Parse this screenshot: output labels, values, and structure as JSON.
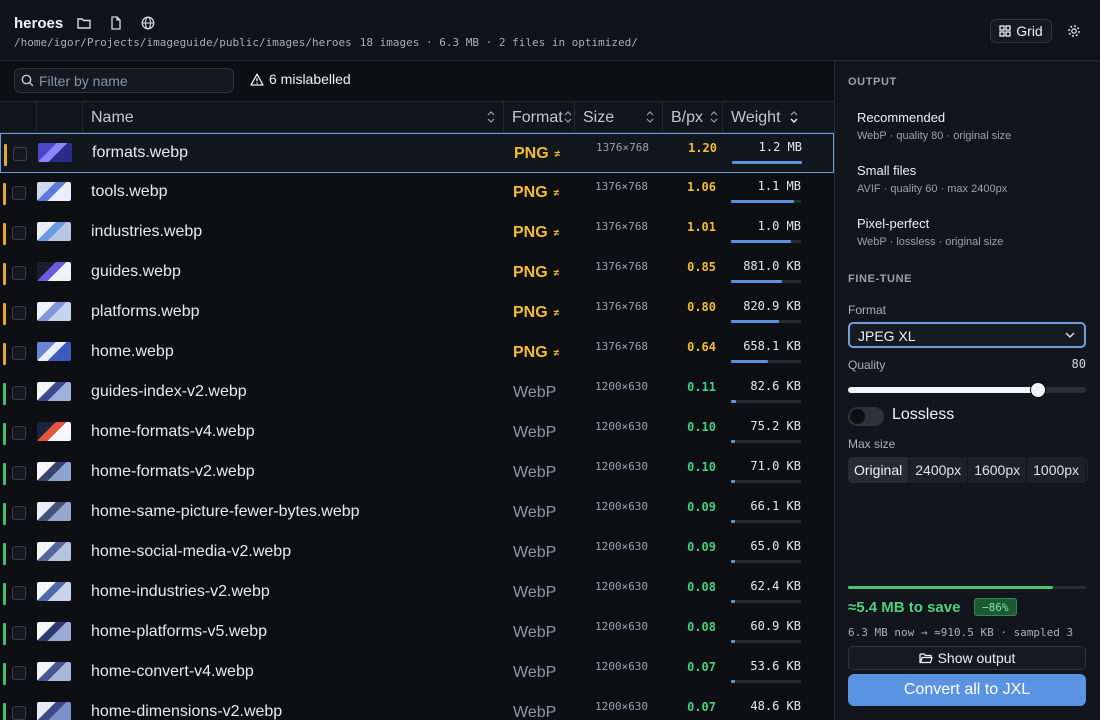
{
  "header": {
    "title": "heroes",
    "path": "/home/igor/Projects/imageguide/public/images/heroes",
    "stats": "18 images · 6.3 MB · 2 files in optimized/",
    "grid_label": "Grid"
  },
  "toolbar": {
    "filter_placeholder": "Filter by name",
    "mislabelled": "6 mislabelled"
  },
  "table": {
    "columns": [
      "Name",
      "Format",
      "Size",
      "B/px",
      "Weight"
    ],
    "rows": [
      {
        "name": "formats.webp",
        "format": "PNG",
        "mismatch": "≠",
        "dims": "1376×768",
        "bpx": "1.20",
        "weight": "1.2 MB",
        "weight_fraction": 1.0,
        "selected": true
      },
      {
        "name": "tools.webp",
        "format": "PNG",
        "mismatch": "≠",
        "dims": "1376×768",
        "bpx": "1.06",
        "weight": "1.1 MB",
        "weight_fraction": 0.9
      },
      {
        "name": "industries.webp",
        "format": "PNG",
        "mismatch": "≠",
        "dims": "1376×768",
        "bpx": "1.01",
        "weight": "1.0 MB",
        "weight_fraction": 0.86
      },
      {
        "name": "guides.webp",
        "format": "PNG",
        "mismatch": "≠",
        "dims": "1376×768",
        "bpx": "0.85",
        "weight": "881.0 KB",
        "weight_fraction": 0.73
      },
      {
        "name": "platforms.webp",
        "format": "PNG",
        "mismatch": "≠",
        "dims": "1376×768",
        "bpx": "0.80",
        "weight": "820.9 KB",
        "weight_fraction": 0.68
      },
      {
        "name": "home.webp",
        "format": "PNG",
        "mismatch": "≠",
        "dims": "1376×768",
        "bpx": "0.64",
        "weight": "658.1 KB",
        "weight_fraction": 0.53
      },
      {
        "name": "guides-index-v2.webp",
        "format": "WebP",
        "dims": "1200×630",
        "bpx": "0.11",
        "weight": "82.6 KB",
        "weight_fraction": 0.07
      },
      {
        "name": "home-formats-v4.webp",
        "format": "WebP",
        "dims": "1200×630",
        "bpx": "0.10",
        "weight": "75.2 KB",
        "weight_fraction": 0.06
      },
      {
        "name": "home-formats-v2.webp",
        "format": "WebP",
        "dims": "1200×630",
        "bpx": "0.10",
        "weight": "71.0 KB",
        "weight_fraction": 0.06
      },
      {
        "name": "home-same-picture-fewer-bytes.webp",
        "format": "WebP",
        "dims": "1200×630",
        "bpx": "0.09",
        "weight": "66.1 KB",
        "weight_fraction": 0.05
      },
      {
        "name": "home-social-media-v2.webp",
        "format": "WebP",
        "dims": "1200×630",
        "bpx": "0.09",
        "weight": "65.0 KB",
        "weight_fraction": 0.05
      },
      {
        "name": "home-industries-v2.webp",
        "format": "WebP",
        "dims": "1200×630",
        "bpx": "0.08",
        "weight": "62.4 KB",
        "weight_fraction": 0.05
      },
      {
        "name": "home-platforms-v5.webp",
        "format": "WebP",
        "dims": "1200×630",
        "bpx": "0.08",
        "weight": "60.9 KB",
        "weight_fraction": 0.05
      },
      {
        "name": "home-convert-v4.webp",
        "format": "WebP",
        "dims": "1200×630",
        "bpx": "0.07",
        "weight": "53.6 KB",
        "weight_fraction": 0.04
      },
      {
        "name": "home-dimensions-v2.webp",
        "format": "WebP",
        "dims": "1200×630",
        "bpx": "0.07",
        "weight": "48.6 KB",
        "weight_fraction": 0.04
      }
    ]
  },
  "panel": {
    "output_title": "OUTPUT",
    "presets": [
      {
        "name": "Recommended",
        "desc": "WebP · quality 80 · original size"
      },
      {
        "name": "Small files",
        "desc": "AVIF · quality 60 · max 2400px"
      },
      {
        "name": "Pixel-perfect",
        "desc": "WebP · lossless · original size"
      }
    ],
    "finetune_title": "FINE-TUNE",
    "format_label": "Format",
    "format_value": "JPEG XL",
    "quality_label": "Quality",
    "quality_value": "80",
    "quality_fraction": 0.8,
    "lossless_label": "Lossless",
    "lossless_on": false,
    "maxsize_label": "Max size",
    "maxsize_options": [
      "Original",
      "2400px",
      "1600px",
      "1000px"
    ],
    "maxsize_selected": "Original",
    "savings": "≈5.4 MB to save",
    "savings_pct": "−86%",
    "savings_fraction": 0.86,
    "savings_detail": "6.3 MB now → ≈910.5 KB · sampled 3",
    "show_output": "Show output",
    "convert": "Convert all to JXL"
  },
  "colors": {
    "accent": "#5b93e3",
    "png": "#f4bd34",
    "good": "#44d07f",
    "bar": "#5c91df"
  }
}
